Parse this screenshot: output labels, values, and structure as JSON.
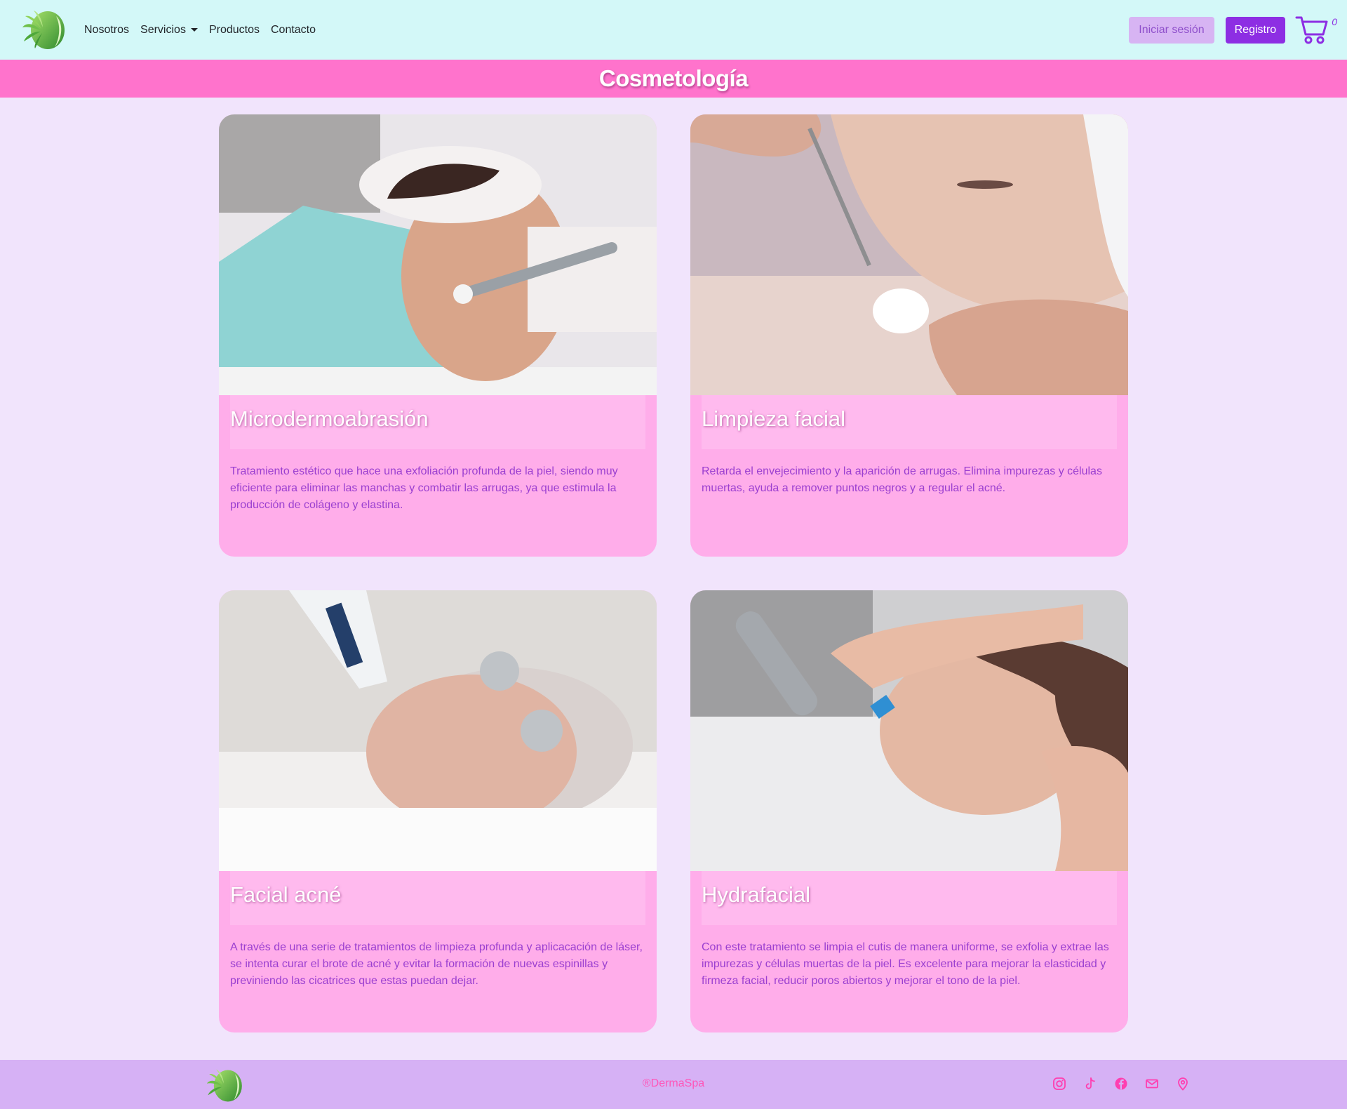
{
  "nav": {
    "logo_icon": "leaf-face-logo-icon",
    "links": [
      {
        "label": "Nosotros"
      },
      {
        "label": "Servicios"
      },
      {
        "label": "Productos"
      },
      {
        "label": "Contacto"
      }
    ],
    "login_label": "Iniciar sesión",
    "register_label": "Registro",
    "cart_icon": "shopping-cart-icon",
    "cart_count": "0"
  },
  "banner": {
    "title": "Cosmetología"
  },
  "cards": [
    {
      "title": "Microdermoabrasión",
      "text": "Tratamiento estético que hace una exfoliación profunda de la piel, siendo muy eficiente para eliminar las manchas y combatir las arrugas, ya que estimula la producción de colágeno y elastina.",
      "image": "photo-microdermabrasion-treatment"
    },
    {
      "title": "Limpieza facial",
      "text": "Retarda el envejecimiento y la aparición de arrugas. Elimina impurezas y células muertas, ayuda a remover puntos negros y a regular el acné.",
      "image": "photo-facial-cleansing-treatment"
    },
    {
      "title": "Facial acné",
      "text": "A través de una serie de tratamientos de limpieza profunda y aplicacación de láser, se intenta curar el brote de acné y evitar la formación de nuevas espinillas y previniendo las cicatrices que estas puedan dejar.",
      "image": "photo-acne-laser-treatment"
    },
    {
      "title": "Hydrafacial",
      "text": "Con este tratamiento se limpia el cutis de manera uniforme, se exfolia y extrae las impurezas y células muertas de la piel. Es excelente para mejorar la elasticidad y firmeza facial, reducir poros abiertos y mejorar el tono de la piel.",
      "image": "photo-hydrafacial-treatment"
    }
  ],
  "footer": {
    "copyright": "®DermaSpa",
    "icons": [
      "instagram-icon",
      "tiktok-icon",
      "facebook-icon",
      "email-icon",
      "location-pin-icon"
    ]
  },
  "colors": {
    "navbar_bg": "#d3f8f8",
    "banner_bg": "#ff73cc",
    "page_bg": "#f1e4fc",
    "card_bg": "#ffadea",
    "accent_purple": "#8d2ee3",
    "footer_bg": "#d6b1f5",
    "footer_accent": "#ff55b8"
  }
}
